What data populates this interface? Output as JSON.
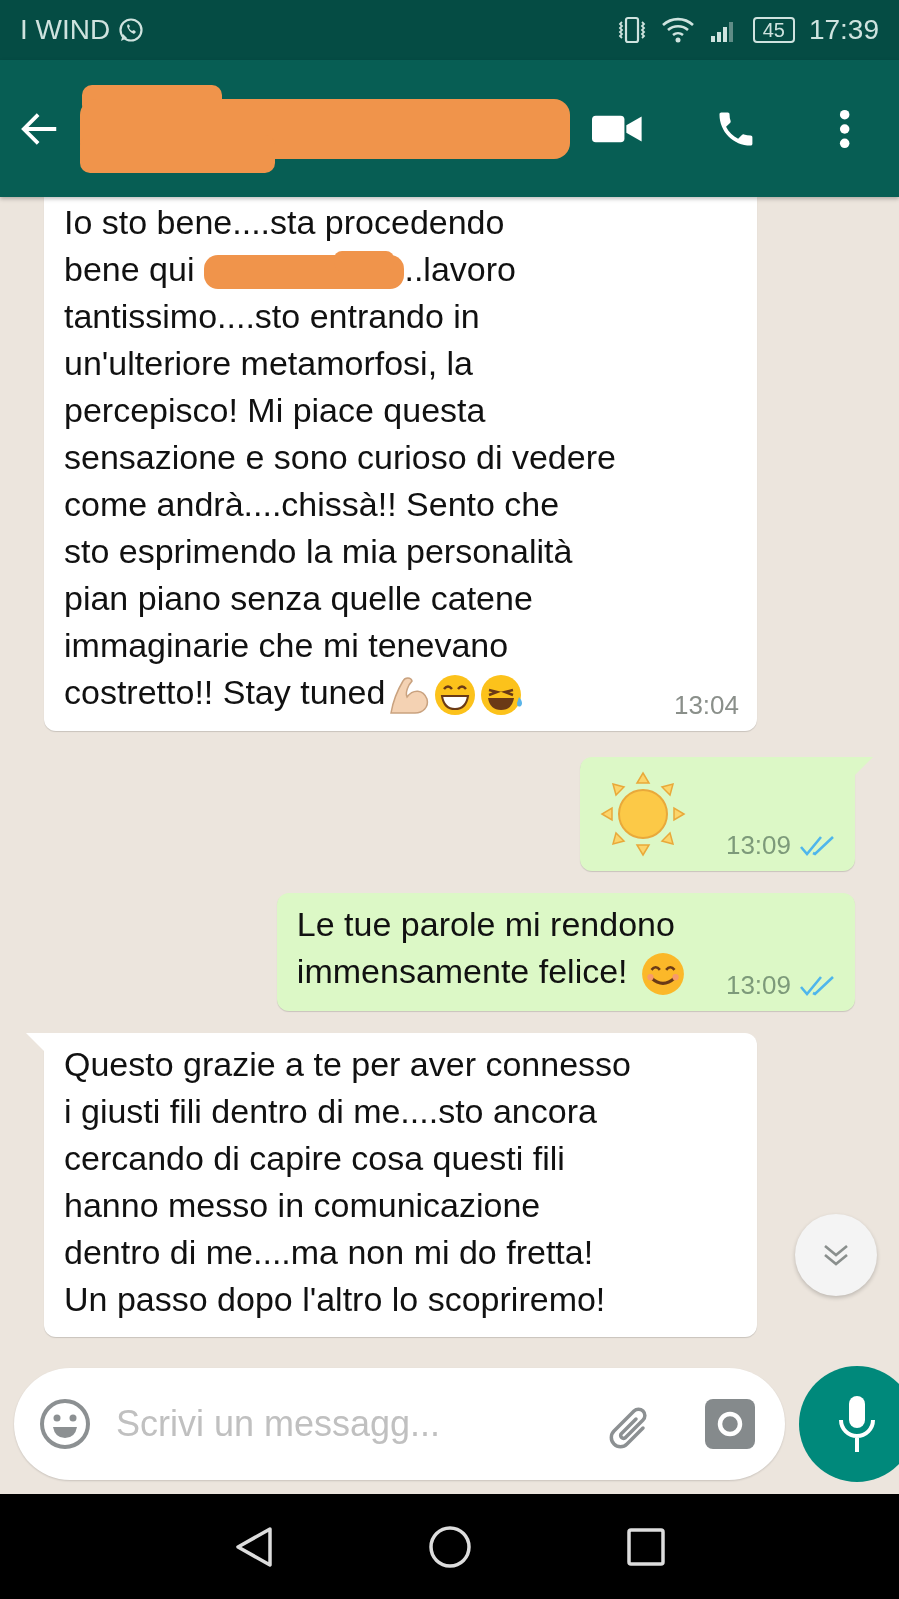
{
  "status_bar": {
    "carrier": "I WIND",
    "battery": "45",
    "time": "17:39"
  },
  "header": {
    "name_redacted": true
  },
  "messages": [
    {
      "kind": "incoming",
      "tail": false,
      "time": "13:04",
      "lines": [
        [
          {
            "kind": "text",
            "text": "Io sto bene....sta procedendo"
          }
        ],
        [
          {
            "kind": "text",
            "text": "bene qui"
          },
          {
            "kind": "redacted"
          },
          {
            "kind": "text",
            "text": "..lavoro"
          }
        ],
        [
          {
            "kind": "text",
            "text": "tantissimo....sto entrando in"
          }
        ],
        [
          {
            "kind": "text",
            "text": "un'ulteriore metamorfosi, la"
          }
        ],
        [
          {
            "kind": "text",
            "text": "percepisco! Mi piace questa"
          }
        ],
        [
          {
            "kind": "text",
            "text": "sensazione e sono curioso di vedere"
          }
        ],
        [
          {
            "kind": "text",
            "text": "come andrà....chissà!! Sento che"
          }
        ],
        [
          {
            "kind": "text",
            "text": "sto esprimendo la mia personalità"
          }
        ],
        [
          {
            "kind": "text",
            "text": "pian piano senza quelle catene"
          }
        ],
        [
          {
            "kind": "text",
            "text": "immaginarie che mi tenevano"
          }
        ],
        [
          {
            "kind": "text",
            "text": "costretto!! Stay tuned"
          },
          {
            "kind": "biceps"
          },
          {
            "kind": "grin"
          },
          {
            "kind": "joy"
          }
        ]
      ]
    },
    {
      "kind": "outgoing",
      "tail": true,
      "time": "13:09",
      "read": true,
      "lines": [
        [
          {
            "kind": "sun"
          }
        ]
      ]
    },
    {
      "kind": "outgoing",
      "tail": false,
      "time": "13:09",
      "read": true,
      "lines": [
        [
          {
            "kind": "text",
            "text": "Le tue parole mi rendono"
          }
        ],
        [
          {
            "kind": "text",
            "text": "immensamente felice!"
          },
          {
            "kind": "smile"
          }
        ]
      ]
    },
    {
      "kind": "incoming",
      "tail": true,
      "lines": [
        [
          {
            "kind": "text",
            "text": "Questo grazie a te per aver connesso"
          }
        ],
        [
          {
            "kind": "text",
            "text": "i giusti fili dentro di me....sto ancora"
          }
        ],
        [
          {
            "kind": "text",
            "text": "cercando di capire cosa questi fili"
          }
        ],
        [
          {
            "kind": "text",
            "text": "hanno messo in comunicazione"
          }
        ],
        [
          {
            "kind": "text",
            "text": "dentro di me....ma non mi do fretta!"
          }
        ],
        [
          {
            "kind": "text",
            "text": "Un passo dopo l'altro lo scopriremo!"
          }
        ]
      ]
    }
  ],
  "composer": {
    "placeholder": "Scrivi un messagg..."
  }
}
